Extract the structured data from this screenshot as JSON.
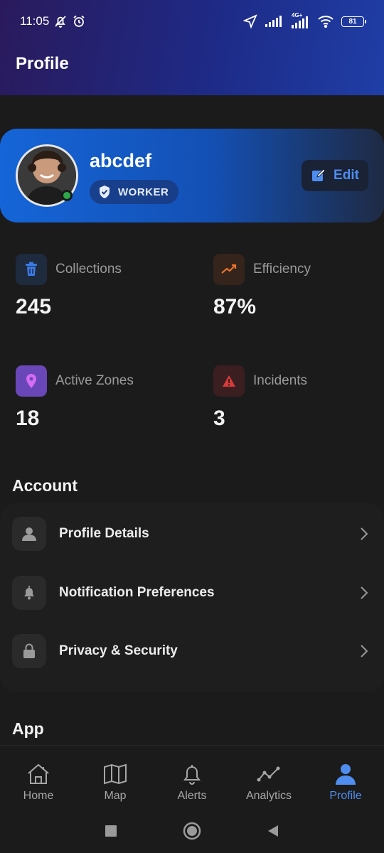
{
  "status_bar": {
    "time": "11:05",
    "network_label": "4G+",
    "battery": "81"
  },
  "header": {
    "title": "Profile"
  },
  "profile": {
    "username": "abcdef",
    "role": "WORKER",
    "edit_label": "Edit",
    "status": "online"
  },
  "stats": [
    {
      "label": "Collections",
      "value": "245",
      "icon": "trash-icon",
      "color": "#3b7be6"
    },
    {
      "label": "Efficiency",
      "value": "87%",
      "icon": "trending-up-icon",
      "color": "#e8742a"
    },
    {
      "label": "Active Zones",
      "value": "18",
      "icon": "map-pin-icon",
      "color": "#b24fd8"
    },
    {
      "label": "Incidents",
      "value": "3",
      "icon": "warning-icon",
      "color": "#d83a3a"
    }
  ],
  "account": {
    "title": "Account",
    "items": [
      {
        "label": "Profile Details",
        "icon": "user-icon"
      },
      {
        "label": "Notification Preferences",
        "icon": "bell-icon"
      },
      {
        "label": "Privacy & Security",
        "icon": "lock-icon"
      }
    ]
  },
  "app_section": {
    "title": "App"
  },
  "bottom_nav": {
    "items": [
      {
        "label": "Home",
        "icon": "home-icon",
        "active": false
      },
      {
        "label": "Map",
        "icon": "map-icon",
        "active": false
      },
      {
        "label": "Alerts",
        "icon": "bell-icon",
        "active": false
      },
      {
        "label": "Analytics",
        "icon": "analytics-icon",
        "active": false
      },
      {
        "label": "Profile",
        "icon": "person-icon",
        "active": true
      }
    ]
  },
  "colors": {
    "accent": "#4f8ef0",
    "card_gradient_start": "#1565d8",
    "background": "#1b1b1b"
  }
}
